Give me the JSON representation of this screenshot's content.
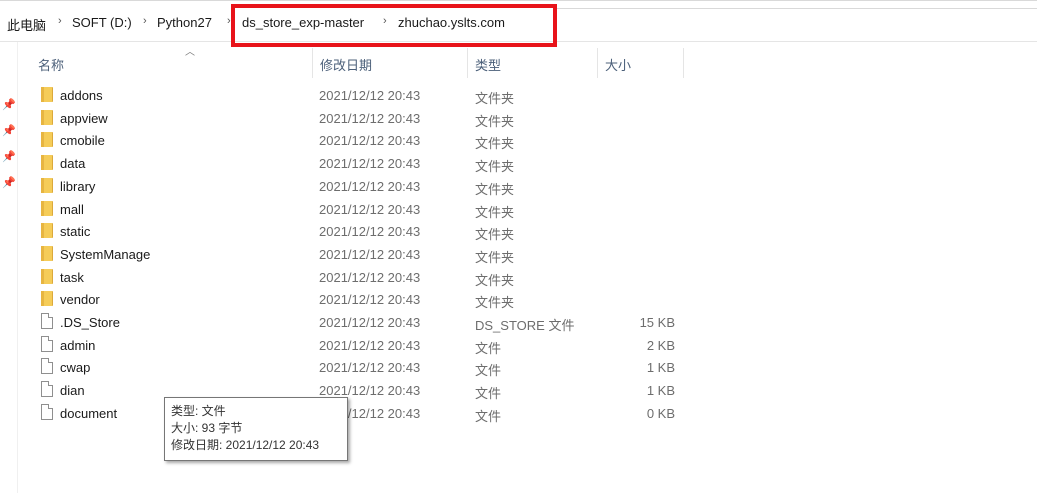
{
  "breadcrumb": {
    "items": [
      "此电脑",
      "SOFT (D:)",
      "Python27",
      "ds_store_exp-master",
      "zhuchao.yslts.com"
    ],
    "separator": "›"
  },
  "highlight_color": "#e8131a",
  "columns": {
    "name": "名称",
    "date": "修改日期",
    "type": "类型",
    "size": "大小"
  },
  "files": [
    {
      "name": "addons",
      "date": "2021/12/12 20:43",
      "type": "文件夹",
      "size": "",
      "kind": "folder"
    },
    {
      "name": "appview",
      "date": "2021/12/12 20:43",
      "type": "文件夹",
      "size": "",
      "kind": "folder"
    },
    {
      "name": "cmobile",
      "date": "2021/12/12 20:43",
      "type": "文件夹",
      "size": "",
      "kind": "folder"
    },
    {
      "name": "data",
      "date": "2021/12/12 20:43",
      "type": "文件夹",
      "size": "",
      "kind": "folder"
    },
    {
      "name": "library",
      "date": "2021/12/12 20:43",
      "type": "文件夹",
      "size": "",
      "kind": "folder"
    },
    {
      "name": "mall",
      "date": "2021/12/12 20:43",
      "type": "文件夹",
      "size": "",
      "kind": "folder"
    },
    {
      "name": "static",
      "date": "2021/12/12 20:43",
      "type": "文件夹",
      "size": "",
      "kind": "folder"
    },
    {
      "name": "SystemManage",
      "date": "2021/12/12 20:43",
      "type": "文件夹",
      "size": "",
      "kind": "folder"
    },
    {
      "name": "task",
      "date": "2021/12/12 20:43",
      "type": "文件夹",
      "size": "",
      "kind": "folder"
    },
    {
      "name": "vendor",
      "date": "2021/12/12 20:43",
      "type": "文件夹",
      "size": "",
      "kind": "folder"
    },
    {
      "name": ".DS_Store",
      "date": "2021/12/12 20:43",
      "type": "DS_STORE 文件",
      "size": "15 KB",
      "kind": "file"
    },
    {
      "name": "admin",
      "date": "2021/12/12 20:43",
      "type": "文件",
      "size": "2 KB",
      "kind": "file"
    },
    {
      "name": "cwap",
      "date": "2021/12/12 20:43",
      "type": "文件",
      "size": "1 KB",
      "kind": "file"
    },
    {
      "name": "dian",
      "date": "2021/12/12 20:43",
      "type": "文件",
      "size": "1 KB",
      "kind": "file"
    },
    {
      "name": "document",
      "date": "2021/12/12 20:43",
      "type": "文件",
      "size": "0 KB",
      "kind": "file"
    }
  ],
  "tooltip": {
    "type_line": "类型: 文件",
    "size_line": "大小: 93 字节",
    "date_line": "修改日期: 2021/12/12 20:43"
  }
}
